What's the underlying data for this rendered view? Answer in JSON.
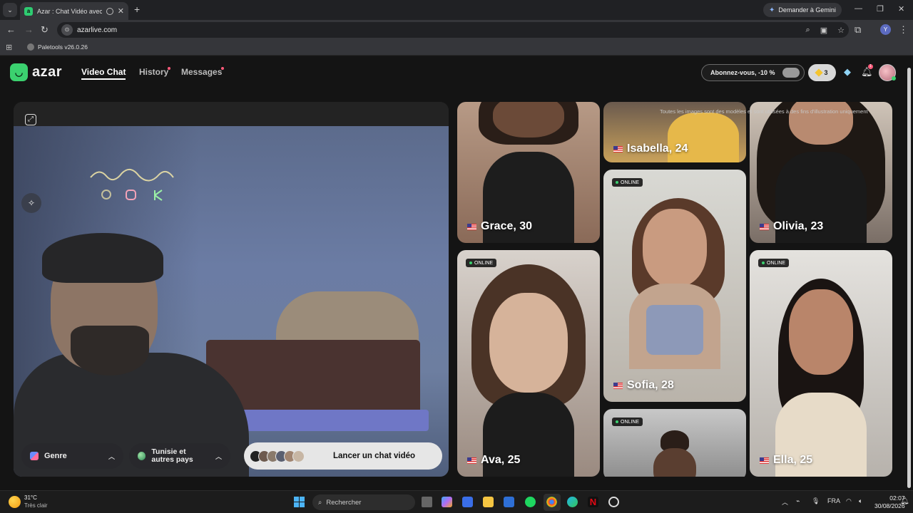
{
  "browser": {
    "tab_title": "Azar : Chat Vidéo avec de n",
    "new_tab": "+",
    "gemini_button": "Demander à Gemini",
    "url": "azarlive.com",
    "profile_initial": "Y",
    "bookmark": "Paletools v26.0.26"
  },
  "nav": {
    "logo": "azar",
    "links": [
      "Video Chat",
      "History",
      "Messages"
    ],
    "subscribe": "Abonnez-vous, -10 %",
    "gems": "3",
    "bell_badge": "1"
  },
  "camera": {
    "genre_label": "Genre",
    "country_label": "Tunisie et autres pays",
    "start_label": "Lancer un chat vidéo"
  },
  "grid": {
    "disclaimer": "Toutes les images sont des modèles et sont utilisées à des fins d'illustration uniquement",
    "online_label": "ONLINE",
    "profiles": [
      {
        "name": "Grace, 30"
      },
      {
        "name": "Isabella, 24"
      },
      {
        "name": "Olivia, 23"
      },
      {
        "name": "Ava, 25"
      },
      {
        "name": "Sofia, 28"
      },
      {
        "name": "Ella, 25"
      }
    ]
  },
  "taskbar": {
    "temperature": "31°C",
    "weather": "Très clair",
    "search_placeholder": "Rechercher",
    "lang": "FRA",
    "time": "02:07",
    "date": "30/08/2026"
  },
  "colors": {
    "brand": "#3bd16f",
    "online_dot": "#3bd16f",
    "notify": "#ff5a7a"
  }
}
